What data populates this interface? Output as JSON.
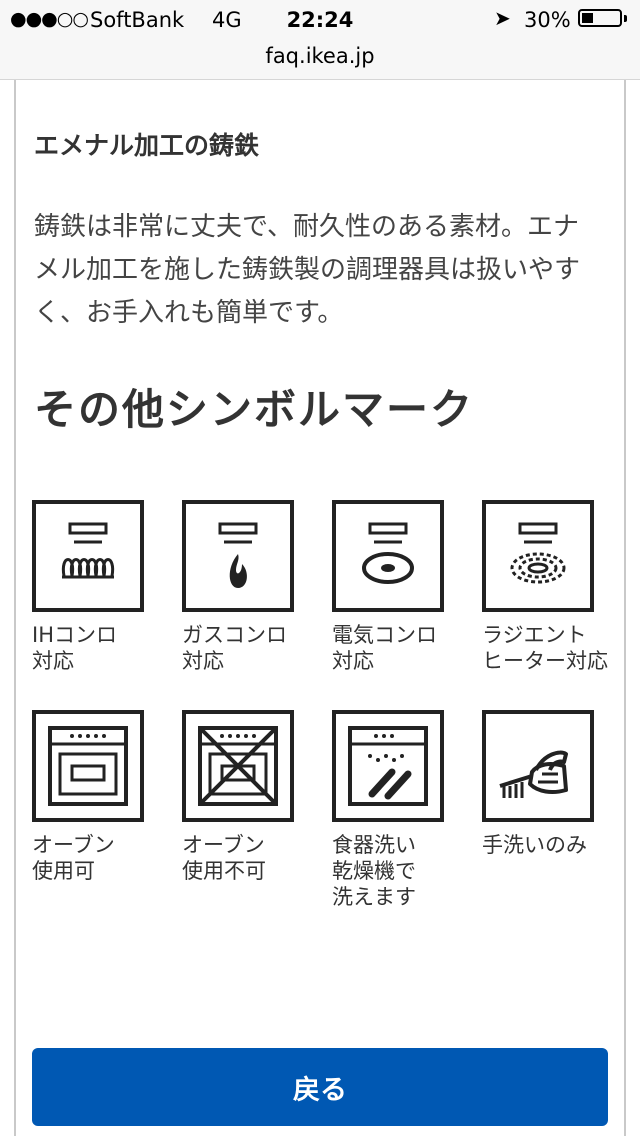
{
  "status": {
    "signal": "●●●○○",
    "carrier": "SoftBank",
    "network": "4G",
    "time": "22:24",
    "battery_pct": "30%",
    "battery_level": 0.3,
    "url": "faq.ikea.jp"
  },
  "content": {
    "section_title": "エメナル加工の鋳鉄",
    "body": "鋳鉄は非常に丈夫で、耐久性のある素材。エナメル加工を施した鋳鉄製の調理器具は扱いやすく、お手入れも簡単です。",
    "heading": "その他シンボルマーク"
  },
  "symbols": [
    {
      "name": "ih-icon",
      "line1": "IHコンロ",
      "line2": "対応",
      "line3": ""
    },
    {
      "name": "gas-icon",
      "line1": "ガスコンロ",
      "line2": "対応",
      "line3": ""
    },
    {
      "name": "electric-icon",
      "line1": "電気コンロ",
      "line2": "対応",
      "line3": ""
    },
    {
      "name": "radiant-icon",
      "line1": "ラジエント",
      "line2": "ヒーター対応",
      "line3": ""
    },
    {
      "name": "oven-ok-icon",
      "line1": "オーブン",
      "line2": "使用可",
      "line3": ""
    },
    {
      "name": "oven-ng-icon",
      "line1": "オーブン",
      "line2": "使用不可",
      "line3": ""
    },
    {
      "name": "dishwasher-icon",
      "line1": "食器洗い",
      "line2": "乾燥機で",
      "line3": "洗えます"
    },
    {
      "name": "handwash-icon",
      "line1": "手洗いのみ",
      "line2": "",
      "line3": ""
    }
  ],
  "back_button": {
    "label": "戻る",
    "color": "#0058b3"
  }
}
